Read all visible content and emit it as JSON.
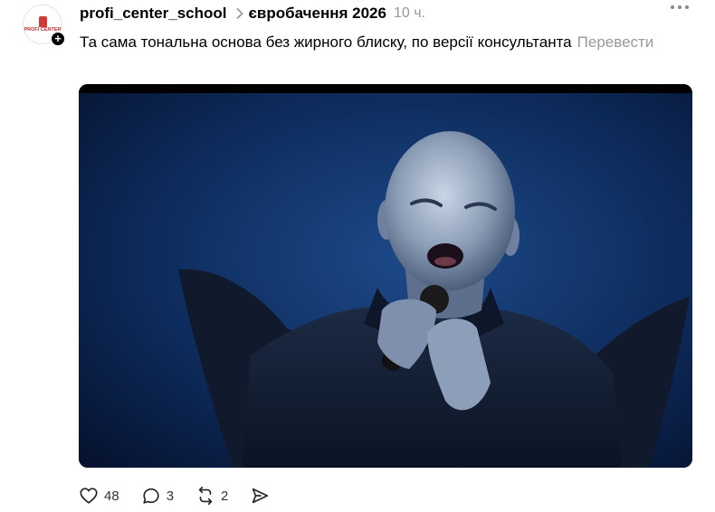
{
  "post": {
    "username": "profi_center_school",
    "topic": "євробачення 2026",
    "time": "10 ч.",
    "text": "Та сама тональна основа без жирного блиску, по версії консультанта",
    "translate_label": "Перевести",
    "avatar_logo_text": "PROFI CENTER"
  },
  "actions": {
    "likes": "48",
    "comments": "3",
    "reposts": "2"
  },
  "icons": {
    "follow": "plus-icon",
    "more": "more-dots-icon",
    "like": "heart-icon",
    "comment": "comment-icon",
    "repost": "repost-icon",
    "share": "send-icon"
  }
}
